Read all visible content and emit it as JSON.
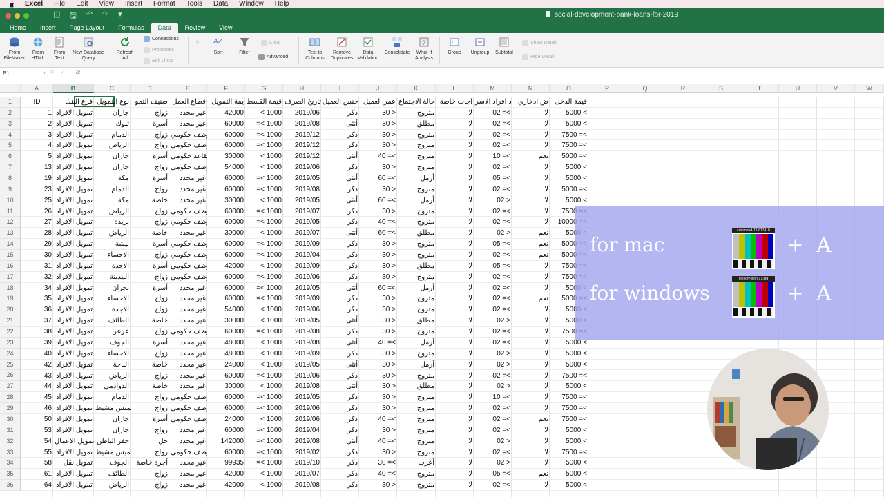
{
  "menubar": {
    "apple": "",
    "items": [
      "Excel",
      "File",
      "Edit",
      "View",
      "Insert",
      "Format",
      "Tools",
      "Data",
      "Window",
      "Help"
    ]
  },
  "window": {
    "doc_title": "social-development-bank-loans-for-2019"
  },
  "ribbon_tabs": [
    "Home",
    "Insert",
    "Page Layout",
    "Formulas",
    "Data",
    "Review",
    "View"
  ],
  "active_tab": "Data",
  "ribbon": {
    "from_filemaker": "From\nFileMaker",
    "from_html": "From\nHTML",
    "from_text": "From\nText",
    "new_db_query": "New Database\nQuery",
    "refresh_all": "Refresh\nAll",
    "connections": "Connections",
    "properties": "Properties",
    "edit_links": "Edit Links",
    "sort": "Sort",
    "filter": "Filter",
    "clear": "Clear",
    "advanced": "Advanced",
    "text_to_columns": "Text to\nColumns",
    "remove_duplicates": "Remove\nDuplicates",
    "data_validation": "Data\nValidation",
    "consolidate": "Consolidate",
    "what_if": "What-If\nAnalysis",
    "group": "Group",
    "ungroup": "Ungroup",
    "subtotal": "Subtotal",
    "show_detail": "Show Detail",
    "hide_detail": "Hide Detail"
  },
  "formula_bar": {
    "name_box": "B1",
    "fx": "fx"
  },
  "columns": [
    "A",
    "B",
    "C",
    "D",
    "E",
    "F",
    "G",
    "H",
    "I",
    "J",
    "K",
    "L",
    "M",
    "N",
    "O",
    "P",
    "Q",
    "R",
    "S",
    "T",
    "U",
    "V",
    "W"
  ],
  "selected_column": "B",
  "row_numbers": [
    "1",
    "2",
    "3",
    "4",
    "5",
    "6",
    "7",
    "8",
    "9",
    "10",
    "11",
    "12",
    "13",
    "14",
    "15",
    "16",
    "17",
    "18",
    "19",
    "20",
    "21",
    "22",
    "23",
    "24",
    "25",
    "26",
    "27",
    "28",
    "29",
    "30",
    "31",
    "32",
    "33",
    "34",
    "35",
    "36"
  ],
  "header_row": [
    "ID",
    "فرع البنك",
    "نوع التمويل",
    "صنيف التمو",
    "قطاع العمل",
    "يمة التمويل",
    "قيمة القسط",
    "تاريخ الصرف",
    "جنس العميل",
    "عمر العميل",
    "حالة الاجتماع",
    "اجات خاصة",
    "د افراد الاسر",
    "ض ادخاري",
    "قيمة الدخل"
  ],
  "rows": [
    [
      "1",
      "تمويل الافراد",
      "جازان",
      "زواج",
      "غير محدد",
      "42000",
      "< 1000",
      "2019/06",
      "ذكر",
      "30 >",
      "متزوج",
      "لا",
      "02 =<",
      "لا",
      "5000 <"
    ],
    [
      "2",
      "تمويل الافراد",
      "تبوك",
      "أسرة",
      "غير محدد",
      "60000",
      "=< 1000",
      "2019/08",
      "أنثى",
      "30 >",
      "مطلق",
      "لا",
      "02 =<",
      "لا",
      "5000 <"
    ],
    [
      "3",
      "تمويل الافراد",
      "الدمام",
      "زواج",
      "موظف حكومي",
      "60000",
      "=< 1000",
      "2019/12",
      "ذكر",
      "30 >",
      "متزوج",
      "لا",
      "02 =<",
      "لا",
      "7500 =<"
    ],
    [
      "4",
      "تمويل الافراد",
      "الرياض",
      "زواج",
      "موظف حكومي",
      "60000",
      "=< 1000",
      "2019/12",
      "ذكر",
      "30 >",
      "متزوج",
      "لا",
      "02 =<",
      "لا",
      "7500 =<"
    ],
    [
      "5",
      "تمويل الافراد",
      "جازان",
      "أسرة",
      "متقاعد حكومي",
      "30000",
      "< 1000",
      "2019/12",
      "أنثى",
      "40 =<",
      "متزوج",
      "لا",
      "10 =<",
      "نعم",
      "5000 =<"
    ],
    [
      "13",
      "تمويل الافراد",
      "جازان",
      "زواج",
      "موظف حكومي",
      "54000",
      "< 1000",
      "2019/06",
      "ذكر",
      "30 >",
      "متزوج",
      "لا",
      "02 =<",
      "لا",
      "5000 <"
    ],
    [
      "19",
      "تمويل الافراد",
      "مكة",
      "أسرة",
      "غير محدد",
      "60000",
      "=< 1000",
      "2019/05",
      "أنثى",
      "60 =<",
      "أرمل",
      "لا",
      "05 =<",
      "لا",
      "5000 <"
    ],
    [
      "23",
      "تمويل الافراد",
      "الدمام",
      "زواج",
      "غير محدد",
      "60000",
      "=< 1000",
      "2019/08",
      "ذكر",
      "30 >",
      "متزوج",
      "لا",
      "02 =<",
      "لا",
      "5000 =<"
    ],
    [
      "25",
      "تمويل الافراد",
      "مكة",
      "خاصة",
      "غير محدد",
      "30000",
      "< 1000",
      "2019/05",
      "أنثى",
      "60 =<",
      "أرمل",
      "لا",
      "02 >",
      "لا",
      "5000 <"
    ],
    [
      "26",
      "تمويل الافراد",
      "الرياض",
      "زواج",
      "موظف حكومي",
      "60000",
      "=< 1000",
      "2019/07",
      "ذكر",
      "30 >",
      "متزوج",
      "لا",
      "02 =<",
      "لا",
      "7500 =<"
    ],
    [
      "27",
      "تمويل الافراد",
      "بريدة",
      "زواج",
      "موظف حكومي",
      "60000",
      "=< 1000",
      "2019/05",
      "ذكر",
      "40 =<",
      "متزوج",
      "لا",
      "02 =<",
      "لا",
      "10000 =<"
    ],
    [
      "28",
      "تمويل الافراد",
      "الرياض",
      "خاصة",
      "غير محدد",
      "30000",
      "< 1000",
      "2019/07",
      "أنثى",
      "60 =<",
      "مطلق",
      "لا",
      "02 >",
      "نعم",
      "5000 <"
    ],
    [
      "29",
      "تمويل الافراد",
      "بيشة",
      "أسرة",
      "موظف حكومي",
      "60000",
      "=< 1000",
      "2019/09",
      "ذكر",
      "30 >",
      "متزوج",
      "لا",
      "05 =<",
      "نعم",
      "5000 =<"
    ],
    [
      "30",
      "تمويل الافراد",
      "الاحساء",
      "زواج",
      "موظف حكومي",
      "60000",
      "=< 1000",
      "2019/04",
      "ذكر",
      "30 >",
      "متزوج",
      "لا",
      "02 =<",
      "نعم",
      "5000 =<"
    ],
    [
      "31",
      "تمويل الافراد",
      "الاجدة",
      "أسرة",
      "موظف حكومي",
      "42000",
      "< 1000",
      "2019/09",
      "ذكر",
      "30 >",
      "مطلق",
      "لا",
      "05 =<",
      "لا",
      "7500 =<"
    ],
    [
      "32",
      "تمويل الافراد",
      "المدينة",
      "زواج",
      "موظف حكومي",
      "60000",
      "=< 1000",
      "2019/06",
      "ذكر",
      "30 >",
      "متزوج",
      "لا",
      "02 =<",
      "لا",
      "7500 =<"
    ],
    [
      "34",
      "تمويل الافراد",
      "نجران",
      "أسرة",
      "غير محدد",
      "60000",
      "=< 1000",
      "2019/05",
      "أنثى",
      "60 =<",
      "أرمل",
      "لا",
      "02 =<",
      "لا",
      "5000 <"
    ],
    [
      "35",
      "تمويل الافراد",
      "الاحساء",
      "زواج",
      "غير محدد",
      "60000",
      "=< 1000",
      "2019/09",
      "ذكر",
      "30 >",
      "متزوج",
      "لا",
      "02 =<",
      "نعم",
      "5000 =<"
    ],
    [
      "36",
      "تمويل الافراد",
      "الاجدة",
      "زواج",
      "غير محدد",
      "54000",
      "< 1000",
      "2019/06",
      "ذكر",
      "30 >",
      "متزوج",
      "لا",
      "02 =<",
      "لا",
      "5000 <"
    ],
    [
      "37",
      "تمويل الافراد",
      "الطائف",
      "خاصة",
      "غير محدد",
      "30000",
      "< 1000",
      "2019/05",
      "أنثى",
      "30 >",
      "مطلق",
      "لا",
      "02 >",
      "لا",
      "5000 <"
    ],
    [
      "38",
      "تمويل الافراد",
      "عرعر",
      "زواج",
      "موظف حكومي",
      "60000",
      "=< 1000",
      "2019/08",
      "ذكر",
      "30 >",
      "متزوج",
      "لا",
      "02 =<",
      "لا",
      "7500 =<"
    ],
    [
      "39",
      "تمويل الافراد",
      "الجوف",
      "أسرة",
      "غير محدد",
      "48000",
      "< 1000",
      "2019/08",
      "أنثى",
      "40 =<",
      "أرمل",
      "لا",
      "02 =<",
      "لا",
      "5000 <"
    ],
    [
      "40",
      "تمويل الافراد",
      "الاحساء",
      "زواج",
      "غير محدد",
      "48000",
      "< 1000",
      "2019/09",
      "ذكر",
      "30 >",
      "متزوج",
      "لا",
      "02 >",
      "لا",
      "5000 <"
    ],
    [
      "42",
      "تمويل الافراد",
      "الباحة",
      "خاصة",
      "غير محدد",
      "24000",
      "< 1000",
      "2019/05",
      "أنثى",
      "30 >",
      "أرمل",
      "لا",
      "02 >",
      "لا",
      "5000 <"
    ],
    [
      "43",
      "تمويل الافراد",
      "الرياض",
      "زواج",
      "غير محدد",
      "60000",
      "=< 1000",
      "2019/06",
      "ذكر",
      "30 >",
      "متزوج",
      "لا",
      "02 =<",
      "لا",
      "7500 =<"
    ],
    [
      "44",
      "تمويل الافراد",
      "الدوادمي",
      "خاصة",
      "غير محدد",
      "30000",
      "< 1000",
      "2019/08",
      "أنثى",
      "30 >",
      "مطلق",
      "لا",
      "02 >",
      "لا",
      "5000 <"
    ],
    [
      "45",
      "تمويل الافراد",
      "الدمام",
      "زواج",
      "موظف حكومي",
      "60000",
      "=< 1000",
      "2019/05",
      "ذكر",
      "30 >",
      "متزوج",
      "لا",
      "10 =<",
      "لا",
      "7500 =<"
    ],
    [
      "46",
      "تمويل الافراد",
      "خميس مشيط",
      "زواج",
      "موظف حكومي",
      "60000",
      "=< 1000",
      "2019/06",
      "ذكر",
      "30 >",
      "متزوج",
      "لا",
      "02 =<",
      "لا",
      "7500 =<"
    ],
    [
      "50",
      "تمويل الافراد",
      "جازان",
      "أسرة",
      "موظف حكومي",
      "24000",
      "< 1000",
      "2019/06",
      "ذكر",
      "40 =<",
      "متزوج",
      "لا",
      "02 =<",
      "نعم",
      "7500 =<"
    ],
    [
      "53",
      "تمويل الافراد",
      "جازان",
      "زواج",
      "غير محدد",
      "60000",
      "=< 1000",
      "2019/04",
      "ذكر",
      "30 >",
      "متزوج",
      "لا",
      "02 =<",
      "لا",
      "5000 <"
    ],
    [
      "54",
      "تمويل الاعمال",
      "حفر الباطن",
      "حل",
      "غير محدد",
      "142000",
      "=< 1000",
      "2019/08",
      "أنثى",
      "40 =<",
      "متزوج",
      "لا",
      "02 >",
      "لا",
      "5000 <"
    ],
    [
      "55",
      "تمويل الافراد",
      "خميس مشيط",
      "زواج",
      "موظف حكومي",
      "60000",
      "=< 1000",
      "2019/02",
      "ذكر",
      "30 >",
      "متزوج",
      "لا",
      "02 =<",
      "لا",
      "7500 =<"
    ],
    [
      "58",
      "تمويل نقل",
      "الجوف",
      "أجرة خاصة",
      "غير محدد",
      "99935",
      "=< 1000",
      "2019/10",
      "ذكر",
      "30 =<",
      "أعزب",
      "لا",
      "02 >",
      "لا",
      "5000 <"
    ],
    [
      "61",
      "تمويل الافراد",
      "الطائف",
      "زواج",
      "غير محدد",
      "42000",
      "< 1000",
      "2019/07",
      "ذكر",
      "40 =<",
      "متزوج",
      "لا",
      "05 =<",
      "نعم",
      "5000 <"
    ],
    [
      "64",
      "تمويل الافراد",
      "الرياض",
      "زواج",
      "غير محدد",
      "42000",
      "< 1000",
      "2019/08",
      "ذكر",
      "30 >",
      "متزوج",
      "لا",
      "02 =<",
      "لا",
      "5000 <"
    ]
  ],
  "overlay": {
    "line1": "for mac",
    "line2": "for windows",
    "key1_label": "command-72-617418",
    "key2_label": "ctrl-key-icon-17.jpg",
    "plus": "+",
    "letter": "A"
  }
}
